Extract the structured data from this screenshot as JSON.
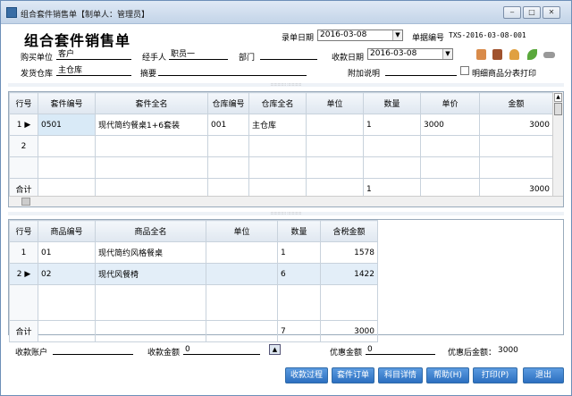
{
  "window": {
    "title": "组合套件销售单【制单人：管理员】",
    "min": "‒",
    "max": "□",
    "close": "✕"
  },
  "header": {
    "title": "组合套件销售单",
    "entry_date_label": "录单日期",
    "entry_date": "2016-03-08",
    "doc_no_label": "单据编号",
    "doc_no": "TXS-2016-03-08-001",
    "buyer_label": "购买单位",
    "buyer": "客户",
    "handler_label": "经手人",
    "handler": "职员一",
    "dept_label": "部门",
    "dept": "",
    "pay_date_label": "收款日期",
    "pay_date": "2016-03-08",
    "warehouse_label": "发货仓库",
    "warehouse": "主仓库",
    "summary_label": "摘要",
    "summary": "",
    "note_label": "附加说明",
    "note": "",
    "detail_print_label": "明细商品分表打印"
  },
  "grid1": {
    "headers": [
      "行号",
      "套件编号",
      "套件全名",
      "仓库编号",
      "仓库全名",
      "单位",
      "数量",
      "单价",
      "金额"
    ],
    "rows": [
      {
        "rn": "1",
        "code": "0501",
        "name": "现代简约餐桌1+6套装",
        "wcode": "001",
        "wname": "主仓库",
        "unit": "",
        "qty": "1",
        "price": "3000",
        "amount": "3000"
      },
      {
        "rn": "2",
        "code": "",
        "name": "",
        "wcode": "",
        "wname": "",
        "unit": "",
        "qty": "",
        "price": "",
        "amount": ""
      }
    ],
    "total_label": "合计",
    "total_qty": "1",
    "total_amount": "3000"
  },
  "grid2": {
    "headers": [
      "行号",
      "商品编号",
      "商品全名",
      "单位",
      "数量",
      "含税金额"
    ],
    "rows": [
      {
        "rn": "1",
        "code": "01",
        "name": "现代简约风格餐桌",
        "unit": "",
        "qty": "1",
        "amount": "1578"
      },
      {
        "rn": "2",
        "code": "02",
        "name": "现代风餐椅",
        "unit": "",
        "qty": "6",
        "amount": "1422"
      }
    ],
    "total_label": "合计",
    "total_qty": "7",
    "total_amount": "3000"
  },
  "footer": {
    "account_label": "收款账户",
    "account": "",
    "received_label": "收款金额",
    "received": "0",
    "discount_label": "优惠金额",
    "discount": "0",
    "after_discount_label": "优惠后金额：",
    "after_discount": "3000"
  },
  "buttons": {
    "process": "收款过程",
    "order": "套件订单",
    "subject": "科目详情",
    "help": "帮助(H)",
    "print": "打印(P)",
    "exit": "退出"
  },
  "colors": {
    "accent": "#2c6fc0",
    "titlebar": "#c3d4e8"
  }
}
